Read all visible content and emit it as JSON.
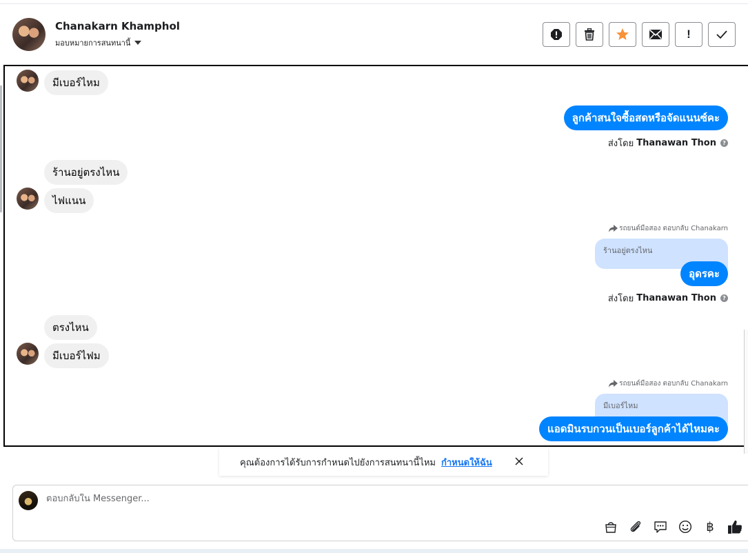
{
  "header": {
    "contact_name": "Chanakarn Khamphol",
    "assign_label": "มอบหมายการสนทนานี้",
    "toolbar": {
      "spam_label": "spam-icon",
      "delete_label": "trash-icon",
      "star_label": "star-icon",
      "mail_label": "envelope-icon",
      "followup_label": "!",
      "done_label": "check-icon"
    }
  },
  "messages": {
    "m1": "มีเบอร์ไหม",
    "m2": "ลูกค้าสนใจซื้อสดหรือจัดแนนซ์คะ",
    "m2_sent_prefix": "ส่งโดย",
    "m2_sent_by": "Thanawan Thon",
    "m3": "ร้านอยู่ตรงไหน",
    "m4": "ไฟแนน",
    "reply1_note": "รถยนต์มือสอง ตอบกลับ Chanakarn",
    "reply1_quote": "ร้านอยู่ตรงไหน",
    "m5": "อุดรคะ",
    "m5_sent_prefix": "ส่งโดย",
    "m5_sent_by": "Thanawan Thon",
    "m6": "ตรงไหน",
    "m7": "มีเบอร์ไฟม",
    "reply2_note": "รถยนต์มือสอง ตอบกลับ Chanakarn",
    "reply2_quote": "มีเบอร์ไหม",
    "m8": "แอดมินรบกวนเป็นเบอร์ลูกค้าได้ไหมคะ"
  },
  "reminder": {
    "text": "คุณต้องการได้รับการกำหนดไปยังการสนทนานี้ไหม",
    "link": "กำหนดให้ฉัน"
  },
  "composer": {
    "placeholder": "ตอบกลับใน Messenger...",
    "baht_symbol": "฿"
  },
  "colors": {
    "outgoing_bubble": "#0084ff",
    "incoming_bubble": "#f0f0f0",
    "quote_bubble": "#cfe2ff",
    "star": "#f7923a",
    "link": "#1877f2"
  }
}
